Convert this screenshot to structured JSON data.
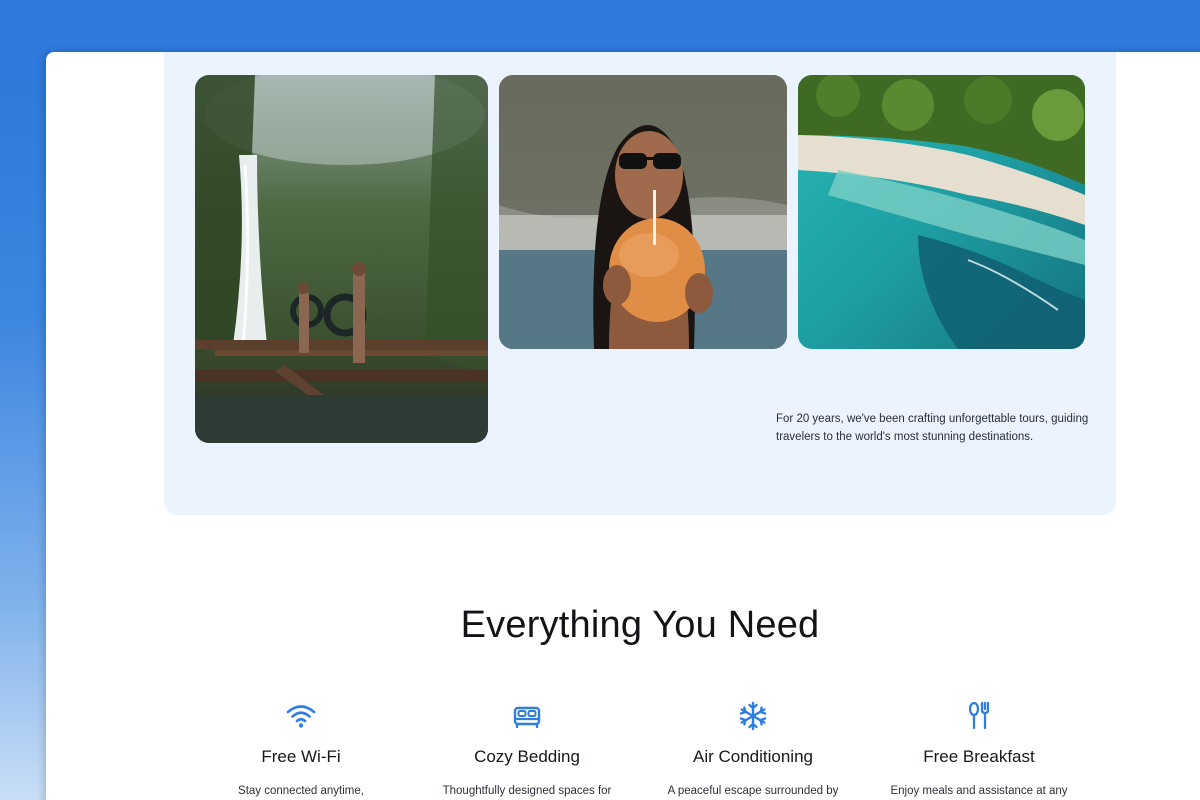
{
  "hero": {
    "caption": "For 20 years, we've been crafting unforgettable tours, guiding travelers to the world's most stunning destinations.",
    "photos": [
      {
        "name": "waterfall-photo"
      },
      {
        "name": "coconut-photo"
      },
      {
        "name": "aerial-coast-photo"
      }
    ]
  },
  "amenities": {
    "title": "Everything You Need",
    "items": [
      {
        "icon": "wifi-icon",
        "title": "Free Wi-Fi",
        "desc": "Stay connected anytime,"
      },
      {
        "icon": "bed-icon",
        "title": "Cozy Bedding",
        "desc": "Thoughtfully designed spaces for"
      },
      {
        "icon": "snowflake-icon",
        "title": "Air Conditioning",
        "desc": "A peaceful escape surrounded by"
      },
      {
        "icon": "utensils-icon",
        "title": "Free Breakfast",
        "desc": "Enjoy meals and assistance at any"
      }
    ]
  },
  "colors": {
    "accent": "#2f7ee0",
    "card_bg": "#eaf3fe",
    "backdrop": "#2e79db"
  }
}
